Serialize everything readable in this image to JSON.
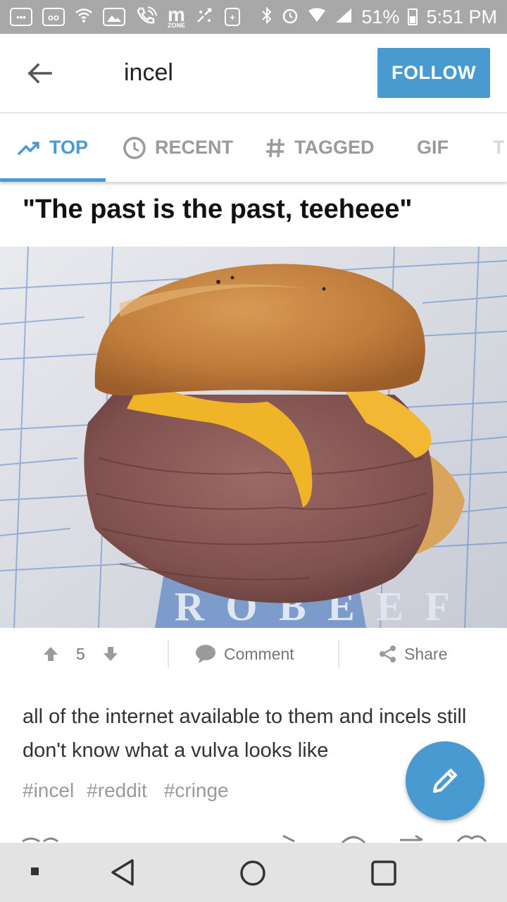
{
  "status_bar": {
    "left_icons": [
      "more-icon",
      "voicemail-icon",
      "wifi-icon",
      "image-icon",
      "phone-wifi-icon",
      "m-zone-icon",
      "sync-icon",
      "battery-plus-icon"
    ],
    "m_zone_label": "m",
    "m_zone_sublabel": "ZONE",
    "battery": "51%",
    "time": "5:51 PM"
  },
  "header": {
    "title": "incel",
    "follow_label": "FOLLOW"
  },
  "tabs": [
    {
      "label": "TOP",
      "icon": "trending-icon",
      "active": true
    },
    {
      "label": "RECENT",
      "icon": "clock-icon",
      "active": false
    },
    {
      "label": "TAGGED",
      "icon": "hash-icon",
      "active": false
    },
    {
      "label": "GIF",
      "icon": "",
      "active": false
    },
    {
      "label": "T",
      "icon": "",
      "active": false
    }
  ],
  "post": {
    "title": "\"The past is the past, teeheee\"",
    "image_text": "R O B E E F",
    "vote_count": "5",
    "comment_label": "Comment",
    "share_label": "Share",
    "caption": "all of the internet available to them and incels still don't know what a vulva looks like",
    "tags": [
      "#incel",
      "#reddit",
      "#cringe"
    ]
  },
  "colors": {
    "accent": "#4a9ad2",
    "status_bar": "#a8a8a8",
    "nav_bar": "#e3e3e3",
    "tab_inactive": "#9a9a9a"
  }
}
